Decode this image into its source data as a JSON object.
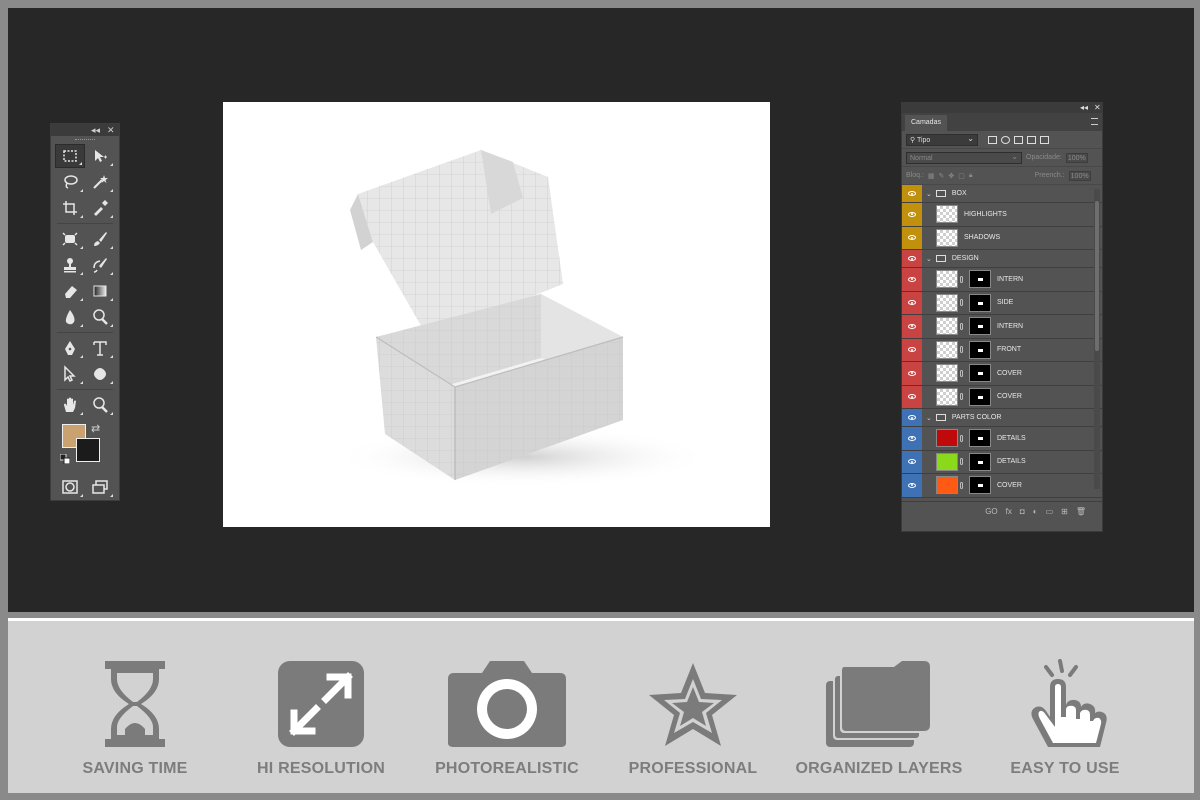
{
  "toolbar": {
    "collapse_glyph": "◂◂",
    "close_glyph": "✕",
    "tools": [
      [
        "marquee-icon",
        "move-icon"
      ],
      [
        "lasso-icon",
        "magic-wand-icon"
      ],
      [
        "crop-icon",
        "eyedropper-icon"
      ],
      [
        "healing-brush-icon",
        "brush-icon"
      ],
      [
        "clone-stamp-icon",
        "history-brush-icon"
      ],
      [
        "eraser-icon",
        "gradient-icon"
      ],
      [
        "blur-icon",
        "dodge-icon"
      ],
      [
        "pen-icon",
        "type-icon"
      ],
      [
        "path-selection-icon",
        "shape-icon"
      ],
      [
        "hand-icon",
        "zoom-icon"
      ]
    ],
    "foreground_color": "#c9a26f",
    "background_color": "#1b1b1b"
  },
  "layers_panel": {
    "collapse_glyph": "◂◂",
    "close_glyph": "✕",
    "tab": "Camadas",
    "filter_kind": "Tipo",
    "blend_mode": "Normal",
    "opacity_label": "Opacidade:",
    "opacity_value": "100%",
    "lock_label": "Bloq.:",
    "fill_label": "Preench.:",
    "fill_value": "100%",
    "layers": [
      {
        "name": "BOX",
        "kind": "group",
        "tag": "#c1900c"
      },
      {
        "name": "HIGHLIGHTS",
        "kind": "layer",
        "tag": "#c1900c"
      },
      {
        "name": "SHADOWS",
        "kind": "layer",
        "tag": "#c1900c"
      },
      {
        "name": "DESIGN",
        "kind": "group",
        "tag": "#c94343"
      },
      {
        "name": "INTERN",
        "kind": "masked",
        "tag": "#c94343"
      },
      {
        "name": "SIDE",
        "kind": "masked",
        "tag": "#c94343"
      },
      {
        "name": "INTERN",
        "kind": "masked",
        "tag": "#c94343"
      },
      {
        "name": "FRONT",
        "kind": "masked",
        "tag": "#c94343"
      },
      {
        "name": "COVER",
        "kind": "masked",
        "tag": "#c94343"
      },
      {
        "name": "COVER",
        "kind": "masked",
        "tag": "#c94343"
      },
      {
        "name": "PARTS COLOR",
        "kind": "group",
        "tag": "#3e72b4"
      },
      {
        "name": "DETAILS",
        "kind": "color",
        "tag": "#3e72b4",
        "fill": "#c0090a"
      },
      {
        "name": "DETAILS",
        "kind": "color",
        "tag": "#3e72b4",
        "fill": "#8ad91a"
      },
      {
        "name": "COVER",
        "kind": "color",
        "tag": "#3e72b4",
        "fill": "#ff5a13"
      }
    ],
    "footer_icons": [
      "link-icon",
      "fx-icon",
      "mask-icon",
      "adjustment-icon",
      "folder-icon",
      "new-layer-icon",
      "trash-icon"
    ],
    "footer_glyphs": [
      "GO",
      "fx",
      "◘",
      "◐",
      "▭",
      "⊞",
      "🗑"
    ]
  },
  "features": [
    {
      "label": "SAVING TIME",
      "icon": "hourglass-icon"
    },
    {
      "label": "HI RESOLUTION",
      "icon": "expand-icon"
    },
    {
      "label": "PHOTOREALISTIC",
      "icon": "camera-icon"
    },
    {
      "label": "PROFESSIONAL",
      "icon": "star-icon"
    },
    {
      "label": "ORGANIZED LAYERS",
      "icon": "layers-icon"
    },
    {
      "label": "EASY TO USE",
      "icon": "hand-tap-icon"
    }
  ]
}
